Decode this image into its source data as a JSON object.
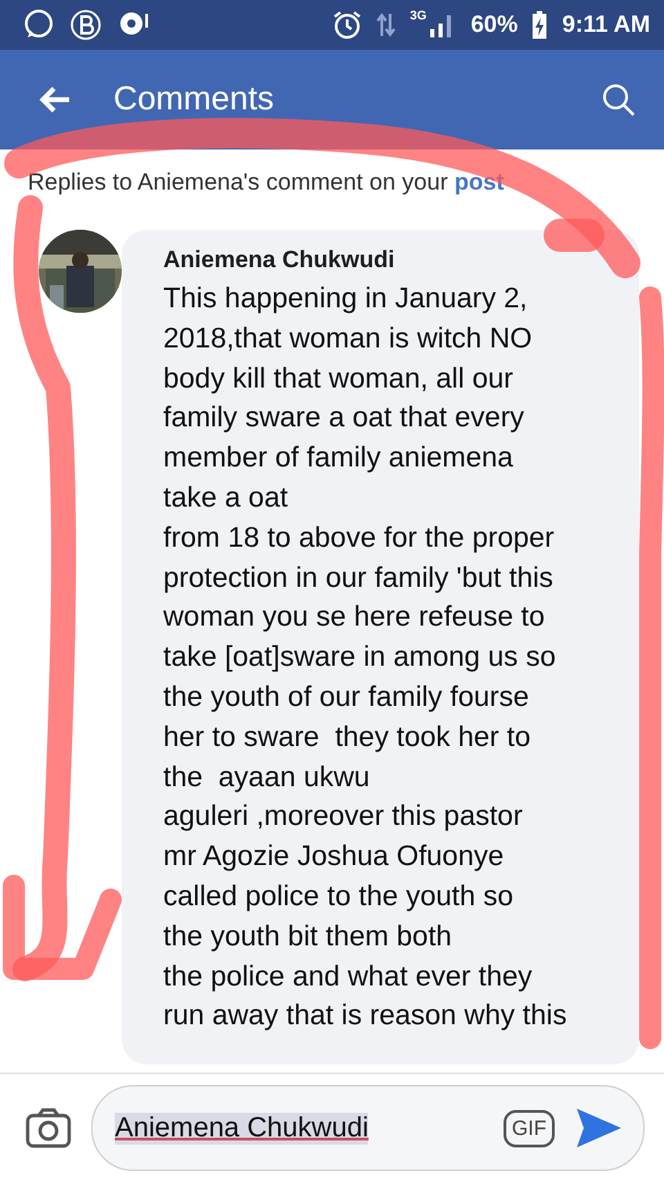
{
  "status_bar": {
    "network": "3G",
    "battery": "60%",
    "time": "9:11 AM"
  },
  "header": {
    "title": "Comments"
  },
  "context": {
    "text": "Replies to Aniemena's comment on your",
    "link": "post"
  },
  "comments": [
    {
      "author": "Aniemena Chukwudi",
      "text": "This happening in January 2,\n2018,that woman is witch NO\nbody kill that woman, all our\nfamily sware a oat that every\nmember of family aniemena\ntake a oat\nfrom 18 to above for the proper\nprotection in our family 'but this\nwoman you se here refeuse to\ntake [oat]sware in among us so\nthe youth of our family fourse\nher to sware  they took her to\nthe  ayaan ukwu\naguleri ,moreover this pastor\nmr Agozie Joshua Ofuonye\ncalled police to the youth so\nthe youth bit them both\nthe police and what ever they\nrun away that is reason why this"
    }
  ],
  "composer": {
    "value": "Aniemena Chukwudi",
    "gif": "GIF"
  }
}
